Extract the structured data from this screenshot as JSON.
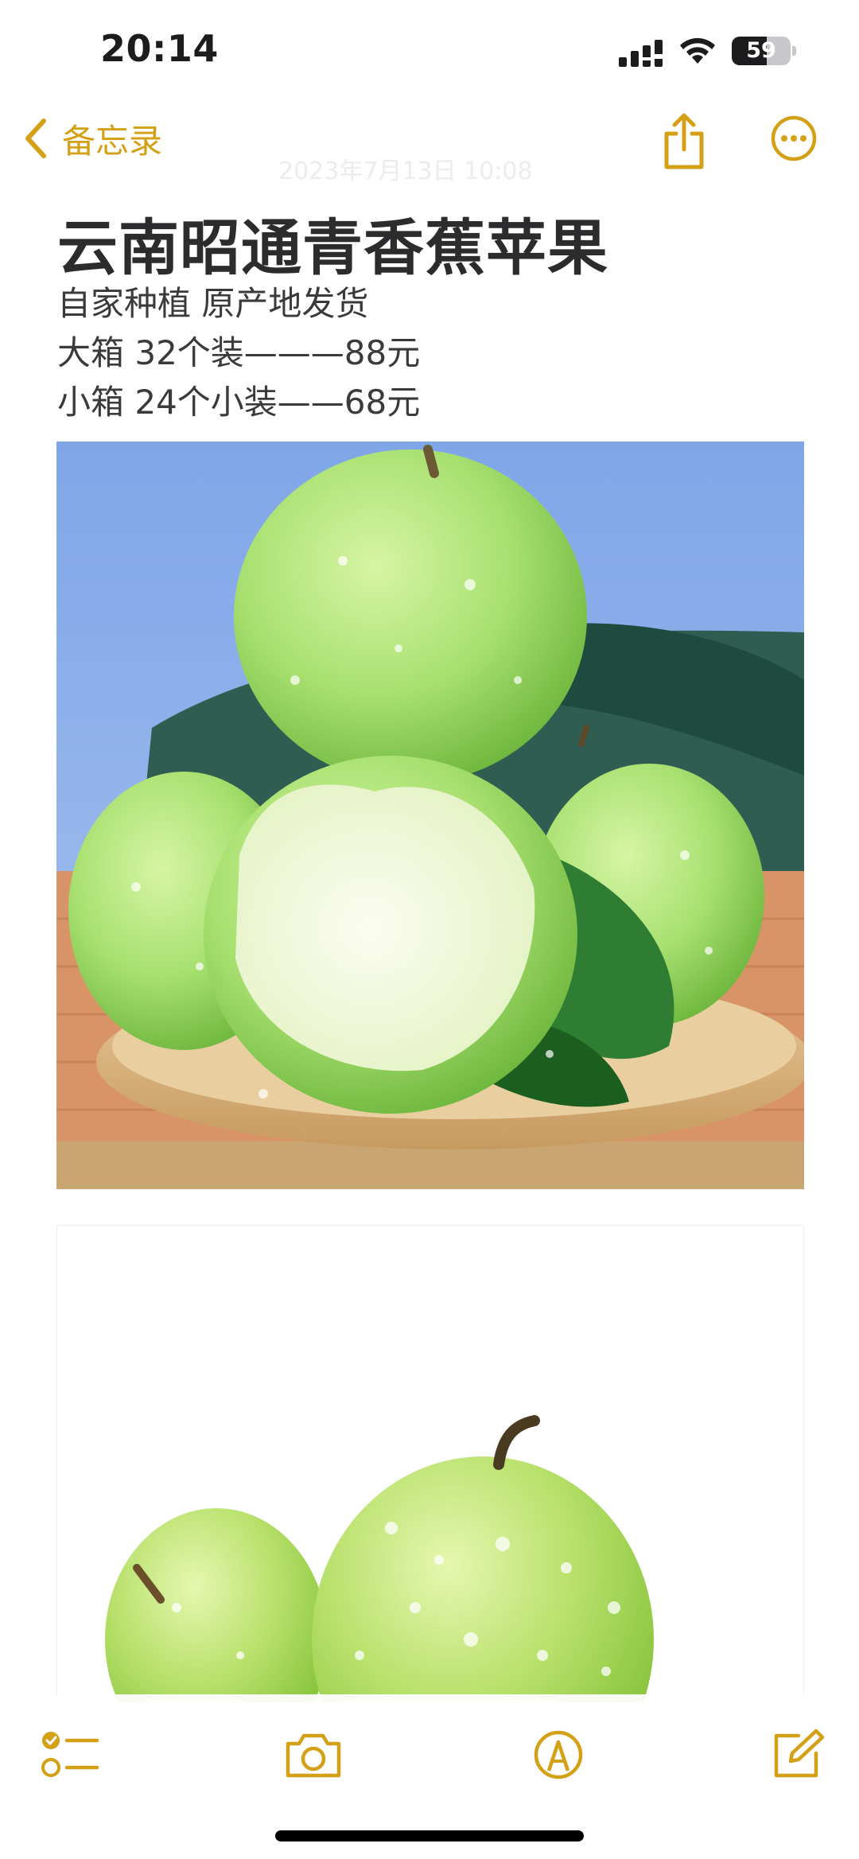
{
  "status_bar": {
    "time": "20:14",
    "battery_level": "59",
    "icons": [
      "signal-icon",
      "wifi-icon",
      "battery-icon"
    ]
  },
  "nav": {
    "back_label": "备忘录",
    "date": "2023年7月13日 10:08",
    "icons": [
      "chevron-left-icon",
      "share-icon",
      "more-icon"
    ]
  },
  "note": {
    "title": "云南昭通青香蕉苹果",
    "lines": [
      "自家种植 原产地发货",
      "大箱 32个装———88元",
      "小箱 24个小装——68元"
    ],
    "images": [
      "green-apples-on-wooden-plate",
      "green-apples-on-white"
    ]
  },
  "toolbar": {
    "icons": [
      "checklist-icon",
      "camera-icon",
      "markup-pen-icon",
      "compose-icon"
    ]
  },
  "colors": {
    "accent": "#d4a016",
    "text": "#2c2c2e"
  }
}
